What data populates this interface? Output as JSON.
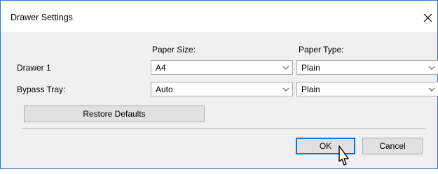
{
  "window": {
    "title": "Drawer Settings",
    "close_icon": "close-icon"
  },
  "columns": {
    "paper_size": "Paper Size:",
    "paper_type": "Paper Type:"
  },
  "rows": [
    {
      "label": "Drawer 1",
      "paper_size": "A4",
      "paper_type": "Plain"
    },
    {
      "label": "Bypass Tray:",
      "paper_size": "Auto",
      "paper_type": "Plain"
    }
  ],
  "buttons": {
    "restore_defaults": "Restore Defaults",
    "ok": "OK",
    "cancel": "Cancel"
  },
  "colors": {
    "window_border": "#2b78c6",
    "content_bg": "#f0f0f0",
    "default_button_border": "#0078d7"
  }
}
